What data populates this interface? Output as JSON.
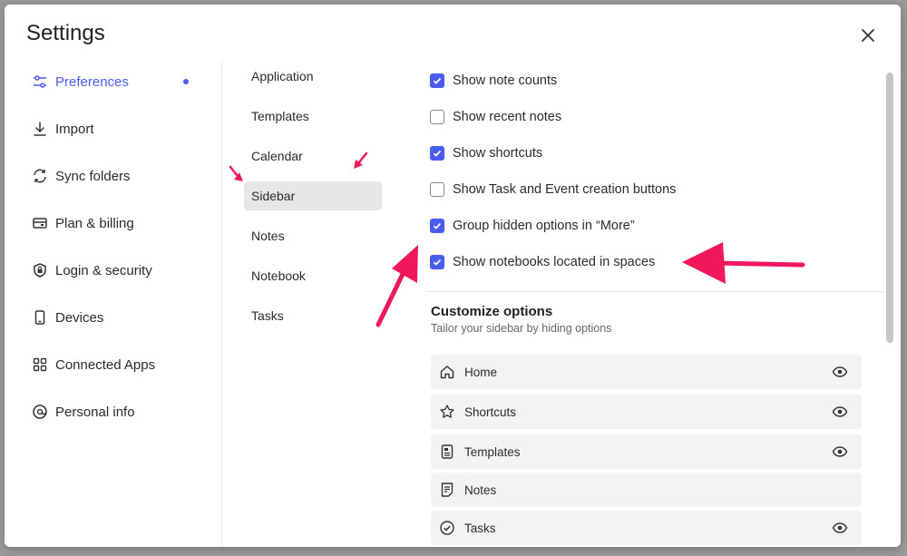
{
  "modal": {
    "title": "Settings"
  },
  "nav": [
    {
      "label": "Preferences",
      "icon": "sliders-icon",
      "active": true
    },
    {
      "label": "Import",
      "icon": "download-icon"
    },
    {
      "label": "Sync folders",
      "icon": "sync-icon"
    },
    {
      "label": "Plan & billing",
      "icon": "credit-card-icon"
    },
    {
      "label": "Login & security",
      "icon": "shield-lock-icon"
    },
    {
      "label": "Devices",
      "icon": "phone-icon"
    },
    {
      "label": "Connected Apps",
      "icon": "apps-grid-icon"
    },
    {
      "label": "Personal info",
      "icon": "at-sign-icon"
    }
  ],
  "subnav": [
    {
      "label": "Application"
    },
    {
      "label": "Templates"
    },
    {
      "label": "Calendar"
    },
    {
      "label": "Sidebar",
      "active": true
    },
    {
      "label": "Notes"
    },
    {
      "label": "Notebook"
    },
    {
      "label": "Tasks"
    }
  ],
  "options": [
    {
      "label": "Show note counts",
      "checked": true
    },
    {
      "label": "Show recent notes",
      "checked": false
    },
    {
      "label": "Show shortcuts",
      "checked": true
    },
    {
      "label": "Show Task and Event creation buttons",
      "checked": false
    },
    {
      "label": "Group hidden options in “More”",
      "checked": true
    },
    {
      "label": "Show notebooks located in spaces",
      "checked": true
    }
  ],
  "customize": {
    "title": "Customize options",
    "subtitle": "Tailor your sidebar by hiding options",
    "items": [
      {
        "label": "Home",
        "icon": "home-icon",
        "visible_toggle": true
      },
      {
        "label": "Shortcuts",
        "icon": "star-icon",
        "visible_toggle": true
      },
      {
        "label": "Templates",
        "icon": "template-doc-icon",
        "visible_toggle": true
      },
      {
        "label": "Notes",
        "icon": "note-icon",
        "visible_toggle": false
      },
      {
        "label": "Tasks",
        "icon": "check-circle-icon",
        "visible_toggle": true
      }
    ]
  },
  "colors": {
    "accent": "#4a5cf0",
    "annotation_arrow": "#f0185a"
  }
}
